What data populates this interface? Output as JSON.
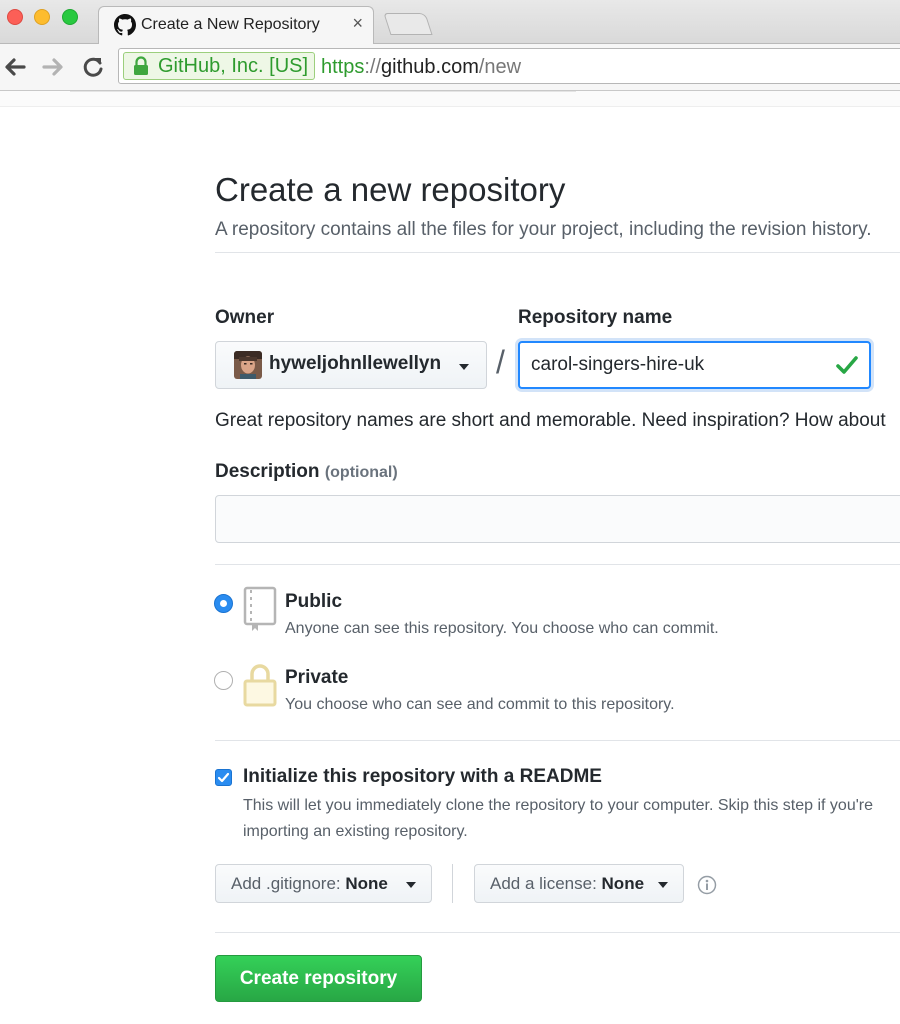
{
  "browser": {
    "tab_title": "Create a New Repository",
    "tab_close": "×",
    "ev_label": "GitHub, Inc. [US]",
    "url": {
      "scheme": "https",
      "separator": "://",
      "host": "github.com",
      "path": "/new"
    }
  },
  "page": {
    "title": "Create a new repository",
    "subtitle": "A repository contains all the files for your project, including the revision history."
  },
  "form": {
    "owner_label": "Owner",
    "owner_value": "hyweljohnllewellyn",
    "slash": "/",
    "repo_label": "Repository name",
    "repo_value": "carol-singers-hire-uk",
    "hint": "Great repository names are short and memorable. Need inspiration? How about",
    "description_label": "Description",
    "description_optional": "(optional)",
    "description_value": ""
  },
  "visibility": [
    {
      "title": "Public",
      "note": "Anyone can see this repository. You choose who can commit.",
      "selected": true
    },
    {
      "title": "Private",
      "note": "You choose who can see and commit to this repository.",
      "selected": false
    }
  ],
  "readme": {
    "checked": true,
    "title": "Initialize this repository with a README",
    "note": "This will let you immediately clone the repository to your computer. Skip this step if you're importing an existing repository."
  },
  "gitignore": {
    "label": "Add .gitignore:",
    "value": "None"
  },
  "license": {
    "label": "Add a license:",
    "value": "None"
  },
  "submit_label": "Create repository",
  "colors": {
    "accent_blue": "#2188ff",
    "valid_green": "#28a745",
    "button_green": "#2ea44f"
  },
  "icons": {
    "tab": "github-octocat-icon",
    "secure": "lock-icon",
    "back": "arrow-left-icon",
    "forward": "arrow-right-icon",
    "reload": "reload-icon",
    "valid": "check-icon",
    "public": "repo-book-icon",
    "private": "padlock-icon",
    "info": "info-icon"
  }
}
